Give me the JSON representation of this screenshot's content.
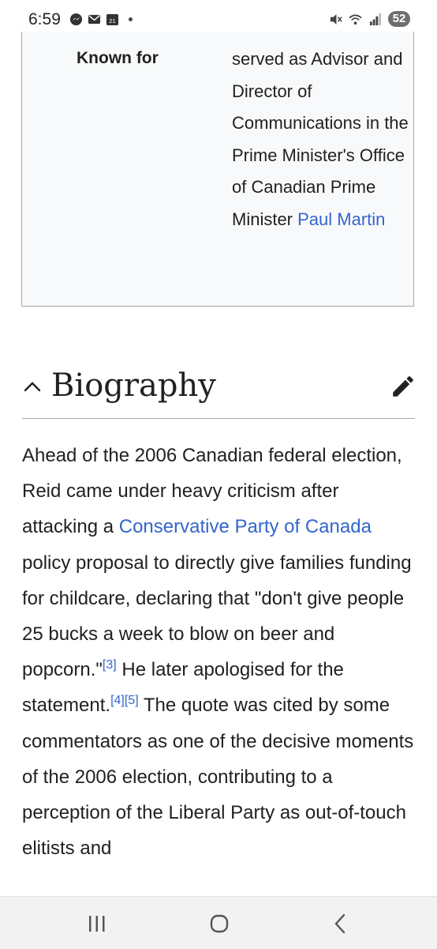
{
  "status_bar": {
    "time": "6:59",
    "calendar_day": "21",
    "battery_level": "52",
    "left_icons": [
      "messenger-icon",
      "mail-icon",
      "calendar-icon",
      "dot-icon"
    ],
    "right_icons": [
      "mute-icon",
      "wifi-icon",
      "signal-icon",
      "battery-icon"
    ]
  },
  "infobox": {
    "label": "Known for",
    "value_text": "served as Advisor and Director of Communications in the Prime Minister's Office of Canadian Prime Minister ",
    "value_link": "Paul Martin"
  },
  "section": {
    "title": "Biography",
    "collapse_icon": "chevron-up-icon",
    "edit_icon": "pencil-icon"
  },
  "paragraph": {
    "t1": "Ahead of the 2006 Canadian federal election, Reid came under heavy criticism after attacking a ",
    "link1": "Conservative Party of Canada",
    "t2": " policy proposal to directly give families funding for childcare, declaring that \"don't give people 25 bucks a week to blow on beer and popcorn.\"",
    "ref1": "[3]",
    "t3": " He later apologised for the statement.",
    "ref2": "[4]",
    "ref3": "[5]",
    "t4": " The quote was cited by some commentators as one of the decisive moments of the 2006 election, contributing to a perception of the Liberal Party as out-of-touch elitists and"
  },
  "nav_bar": {
    "buttons": [
      "recent-apps",
      "home",
      "back"
    ]
  },
  "colors": {
    "link": "#3366cc",
    "text": "#202122",
    "infobox_bg": "#f8f9fa",
    "border": "#a2a9b1"
  }
}
